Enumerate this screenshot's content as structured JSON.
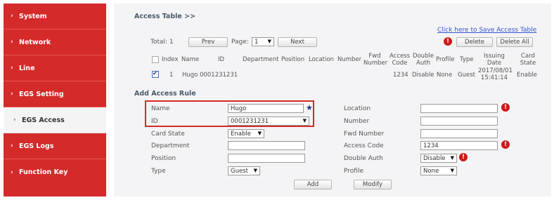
{
  "sidebar": {
    "items": [
      {
        "label": "System",
        "active": false
      },
      {
        "label": "Network",
        "active": false
      },
      {
        "label": "Line",
        "active": false
      },
      {
        "label": "EGS Setting",
        "active": false
      },
      {
        "label": "EGS Access",
        "active": true
      },
      {
        "label": "EGS Logs",
        "active": false
      },
      {
        "label": "Function Key",
        "active": false
      }
    ]
  },
  "access_table": {
    "title": "Access Table >>",
    "save_link": "Click here to Save Access Table",
    "total_label": "Total: 1",
    "prev_label": "Prev",
    "page_label": "Page:",
    "page_value": "1",
    "next_label": "Next",
    "delete_label": "Delete",
    "delete_all_label": "Delete All",
    "headers": {
      "index": "Index",
      "name": "Name",
      "id": "ID",
      "department": "Department",
      "position": "Position",
      "location": "Location",
      "number": "Number",
      "fwd_number_1": "Fwd",
      "fwd_number_2": "Number",
      "access_code_1": "Access",
      "access_code_2": "Code",
      "double_auth_1": "Double",
      "double_auth_2": "Auth",
      "profile": "Profile",
      "type": "Type",
      "issuing_date_1": "Issuing",
      "issuing_date_2": "Date",
      "card_state_1": "Card",
      "card_state_2": "State"
    },
    "row": {
      "index": "1",
      "name_id": "Hugo 0001231231",
      "access_code": "1234",
      "double_auth": "Disable",
      "profile": "None",
      "type": "Guest",
      "issuing_date_1": "2017/08/01",
      "issuing_date_2": "15:41:14",
      "card_state": "Enable"
    }
  },
  "add_rule": {
    "title": "Add Access Rule",
    "left": {
      "name_label": "Name",
      "name_value": "Hugo",
      "id_label": "ID",
      "id_value": "0001231231",
      "card_state_label": "Card State",
      "card_state_value": "Enable",
      "department_label": "Department",
      "department_value": "",
      "position_label": "Position",
      "position_value": "",
      "type_label": "Type",
      "type_value": "Guest"
    },
    "right": {
      "location_label": "Location",
      "location_value": "",
      "number_label": "Number",
      "number_value": "",
      "fwd_number_label": "Fwd Number",
      "fwd_number_value": "",
      "access_code_label": "Access Code",
      "access_code_value": "1234",
      "double_auth_label": "Double Auth",
      "double_auth_value": "Disable",
      "profile_label": "Profile",
      "profile_value": "None"
    },
    "add_label": "Add",
    "modify_label": "Modify"
  },
  "icons": {
    "warning": "!",
    "star": "★",
    "chevron": "›",
    "dropdown": "▼"
  },
  "colors": {
    "sidebar_bg": "#d42a2a",
    "warning": "#d01818",
    "link": "#3355cc"
  }
}
